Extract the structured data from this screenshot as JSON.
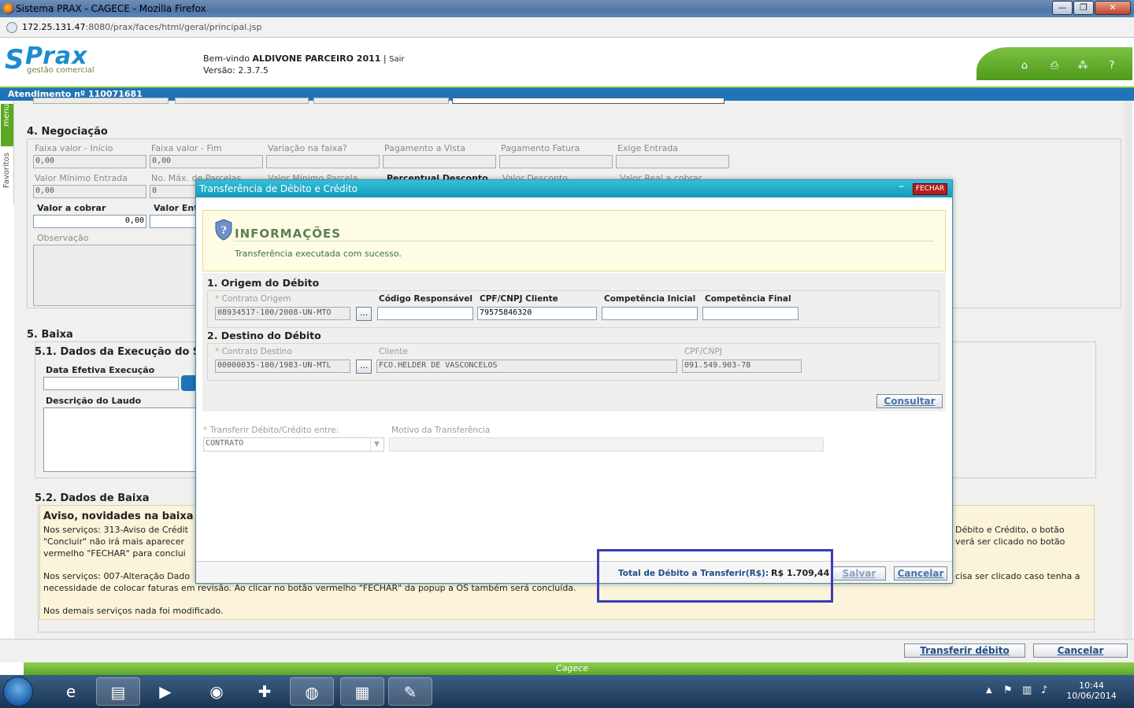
{
  "browser": {
    "title": "Sistema PRAX - CAGECE - Mozilla Firefox",
    "url_host": "172.25.131.47",
    "url_rest": ":8080/prax/faces/html/geral/principal.jsp",
    "btn_min": "—",
    "btn_max": "❐",
    "btn_close": "✕"
  },
  "app": {
    "logo": "Prax",
    "logo_sub": "gestão comercial",
    "welcome_prefix": "Bem-vindo",
    "user": "ALDIVONE PARCEIRO 2011",
    "sep": "|",
    "logout": "Sair",
    "version": "Versão: 2.3.7.5",
    "attendance": "Atendimento nº 110071681",
    "side_menu": "menu",
    "side_fav": "Favoritos"
  },
  "negociacao": {
    "title": "4. Negociação",
    "fields": [
      {
        "label": "Faixa valor - Início",
        "value": "0,00"
      },
      {
        "label": "Faixa valor - Fim",
        "value": "0,00"
      },
      {
        "label": "Variação na faixa?",
        "value": ""
      },
      {
        "label": "Pagamento a Vista",
        "value": ""
      },
      {
        "label": "Pagamento Fatura",
        "value": ""
      },
      {
        "label": "Exige Entrada",
        "value": ""
      }
    ],
    "row2": [
      {
        "label": "Valor Mínimo Entrada",
        "value": "0,00"
      },
      {
        "label": "No. Máx. de Parcelas",
        "value": "0"
      },
      {
        "label": "Valor Mínimo Parcela",
        "value": ""
      },
      {
        "label": "Percentual Desconto",
        "value": ""
      },
      {
        "label": "Valor Desconto",
        "value": ""
      },
      {
        "label": "Valor Real a cobrar",
        "value": ""
      }
    ],
    "valor_cobrar_label": "Valor a cobrar",
    "valor_cobrar": "0,00",
    "valor_entrada_label": "Valor Ent",
    "observacao_label": "Observação"
  },
  "baixa": {
    "title": "5. Baixa",
    "sub1": "5.1. Dados da Execução do S",
    "data_exec_label": "Data Efetiva Execução",
    "laudo_label": "Descrição do Laudo",
    "sub2": "5.2. Dados de Baixa",
    "aviso_title": "Aviso, novidades na baixa",
    "aviso_l1a": "Nos serviços: 313-Aviso de Crédit",
    "aviso_l1b": "Débito e Crédito, o botão",
    "aviso_l2a": "\"Concluir\" não irá mais aparecer",
    "aviso_l2b": "verá ser clicado no botão",
    "aviso_l3a": "vermelho \"FECHAR\" para conclui",
    "aviso_l4a": "Nos serviços: 007-Alteração Dado",
    "aviso_l4b": "cisa ser clicado caso tenha a",
    "aviso_l5": "necessidade de colocar faturas em revisão. Ao clicar no botão vermelho \"FECHAR\" da popup a OS também será concluída.",
    "aviso_l6": "Nos demais serviços nada foi modificado."
  },
  "footer": {
    "transferir": "Transferir débito",
    "cancelar": "Cancelar",
    "brand": "Cagece"
  },
  "modal": {
    "title": "Transferência de Débito e Crédito",
    "minimize": "–",
    "close": "FECHAR",
    "info_title": "INFORMAÇÕES",
    "info_msg": "Transferência executada com sucesso.",
    "origem": {
      "title": "1. Origem do Débito",
      "contrato_label": "Contrato Origem",
      "contrato": "08934517-100/2008-UN-MTO",
      "codigo_label": "Código Responsável",
      "codigo": "",
      "cpf_label": "CPF/CNPJ Cliente",
      "cpf": "79575846320",
      "comp_ini_label": "Competência Inicial",
      "comp_ini": "",
      "comp_fim_label": "Competência Final",
      "comp_fim": ""
    },
    "destino": {
      "title": "2. Destino do Débito",
      "contrato_label": "Contrato Destino",
      "contrato": "00000035-100/1983-UN-MTL",
      "cliente_label": "Cliente",
      "cliente": "FCO.HELDER DE VASCONCELOS",
      "cpf_label": "CPF/CNPJ",
      "cpf": "091.549.903-78"
    },
    "dots": "...",
    "consultar": "Consultar",
    "transferir_label": "Transferir Débito/Crédito entre:",
    "transferir_value": "CONTRATO",
    "motivo_label": "Motivo da Transferência",
    "motivo": "",
    "total_label": "Total de Débito a Transferir(R$):",
    "total_value": "R$ 1.709,44",
    "salvar": "Salvar",
    "cancelar": "Cancelar"
  },
  "taskbar": {
    "time": "10:44",
    "date": "10/06/2014"
  },
  "colors": {
    "accent_blue": "#1f73b8",
    "modal_header": "#1698b9",
    "green": "#5aa823",
    "highlight": "#3a3fb0",
    "close_red": "#b41e1e"
  }
}
